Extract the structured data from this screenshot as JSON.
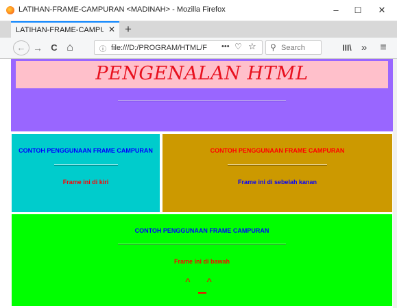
{
  "window": {
    "title": "LATIHAN-FRAME-CAMPURAN <MADINAH> - Mozilla Firefox",
    "minimize": "–",
    "maximize": "☐",
    "close": "✕"
  },
  "tab": {
    "label": "LATIHAN-FRAME-CAMPURAN <M",
    "close": "✕",
    "new_tab": "+"
  },
  "navbar": {
    "back": "←",
    "forward": "→",
    "reload": "C",
    "home": "⌂",
    "url": "file:///D:/PROGRAM/HTML/FR",
    "page_actions": "•••",
    "search_placeholder": "Search",
    "library": "III\\",
    "overflow": "»",
    "menu": "≡"
  },
  "frames": {
    "top": {
      "heading": "PENGENALAN HTML",
      "bg": "#9966ff",
      "heading_bg": "#ffc0cb",
      "heading_color": "#e8101e"
    },
    "left": {
      "title": "CONTOH PENGGUNAAN FRAME CAMPURAN",
      "text": "Frame ini di kiri",
      "bg": "#00cccc",
      "title_color": "#0000ff",
      "text_color": "#ff0000"
    },
    "right": {
      "title": "CONTOH PENGGUNAAN FRAME CAMPURAN",
      "text": "Frame ini di sebelah kanan",
      "bg": "#cc9900",
      "title_color": "#ff0000",
      "text_color": "#0000ff"
    },
    "bottom": {
      "title": "CONTOH PENGGUNAAN FRAME CAMPURAN",
      "text": "Frame ini di bawah",
      "smiley": "^ ^",
      "bg": "#00ff00",
      "title_color": "#0000ff",
      "text_color": "#ff0000"
    }
  },
  "icons": [
    "firefox-logo",
    "back-arrow-icon",
    "forward-arrow-icon",
    "reload-icon",
    "home-icon",
    "info-icon",
    "pocket-icon",
    "star-icon",
    "search-icon",
    "library-icon",
    "overflow-icon",
    "hamburger-menu-icon"
  ]
}
